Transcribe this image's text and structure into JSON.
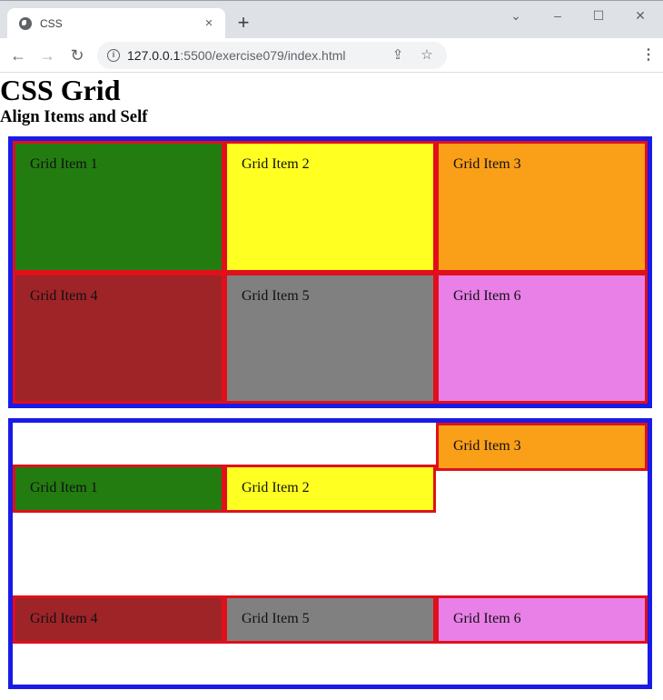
{
  "browser": {
    "tab": {
      "title": "CSS",
      "favicon": "globe-icon",
      "close_glyph": "×"
    },
    "new_tab_glyph": "+",
    "window_controls": {
      "tab_search": "⌄",
      "minimize": "–",
      "maximize": "☐",
      "close": "✕"
    },
    "nav": {
      "back": "←",
      "forward": "→",
      "reload": "↻"
    },
    "address": {
      "host": "127.0.0.1",
      "rest": ":5500/exercise079/index.html",
      "info_glyph": "i"
    },
    "omnibox_icons": {
      "share": "⇪",
      "bookmark": "☆"
    },
    "menu_glyph": "⋮"
  },
  "page": {
    "heading": "CSS Grid",
    "subheading": "Align Items and Self",
    "grid1": {
      "items": [
        {
          "label": "Grid Item 1",
          "color": "#237c10"
        },
        {
          "label": "Grid Item 2",
          "color": "#ffff22"
        },
        {
          "label": "Grid Item 3",
          "color": "#fa9f18"
        },
        {
          "label": "Grid Item 4",
          "color": "#9e2428"
        },
        {
          "label": "Grid Item 5",
          "color": "#808080"
        },
        {
          "label": "Grid Item 6",
          "color": "#e880e8"
        }
      ]
    },
    "grid2": {
      "items": [
        {
          "label": "Grid Item 1",
          "color": "#237c10"
        },
        {
          "label": "Grid Item 2",
          "color": "#ffff22"
        },
        {
          "label": "Grid Item 3",
          "color": "#fa9f18"
        },
        {
          "label": "Grid Item 4",
          "color": "#9e2428"
        },
        {
          "label": "Grid Item 5",
          "color": "#808080"
        },
        {
          "label": "Grid Item 6",
          "color": "#e880e8"
        }
      ]
    },
    "colors": {
      "container_border": "#1a1ae6",
      "item_border": "#e0101a"
    }
  }
}
